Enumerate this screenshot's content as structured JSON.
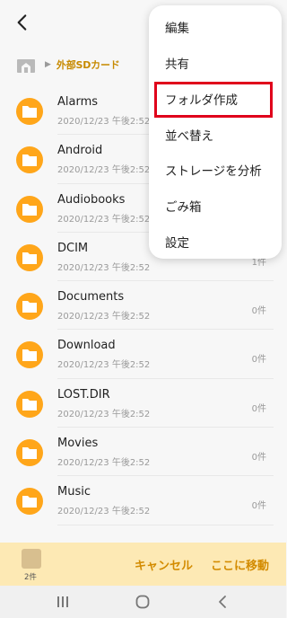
{
  "breadcrumb": {
    "location": "外部SDカード"
  },
  "folders": [
    {
      "name": "Alarms",
      "date": "2020/12/23 午後2:52",
      "count": ""
    },
    {
      "name": "Android",
      "date": "2020/12/23 午後2:52",
      "count": ""
    },
    {
      "name": "Audiobooks",
      "date": "2020/12/23 午後2:52",
      "count": ""
    },
    {
      "name": "DCIM",
      "date": "2020/12/23 午後2:52",
      "count": "1件"
    },
    {
      "name": "Documents",
      "date": "2020/12/23 午後2:52",
      "count": "0件"
    },
    {
      "name": "Download",
      "date": "2020/12/23 午後2:52",
      "count": "0件"
    },
    {
      "name": "LOST.DIR",
      "date": "2020/12/23 午後2:52",
      "count": "0件"
    },
    {
      "name": "Movies",
      "date": "2020/12/23 午後2:52",
      "count": "0件"
    },
    {
      "name": "Music",
      "date": "2020/12/23 午後2:52",
      "count": "0件"
    }
  ],
  "menu": {
    "items": [
      "編集",
      "共有",
      "フォルダ作成",
      "並べ替え",
      "ストレージを分析",
      "ごみ箱",
      "設定"
    ]
  },
  "bottom_bar": {
    "selected_count": "2件",
    "cancel": "キャンセル",
    "move_here": "ここに移動"
  },
  "colors": {
    "accent": "#ffa61a",
    "action": "#d38b00",
    "highlight_box": "#e0001b",
    "bottom_bar_bg": "#fde9b4"
  }
}
